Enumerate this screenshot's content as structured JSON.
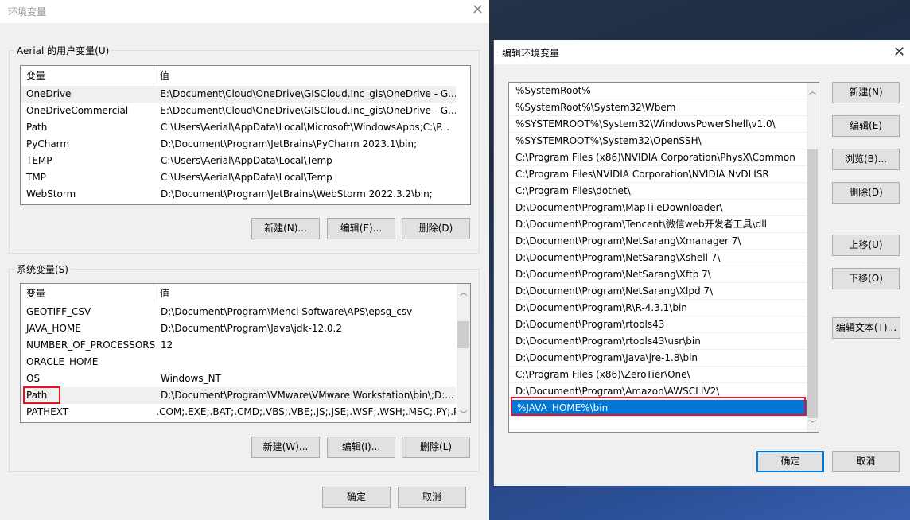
{
  "env_dialog": {
    "title": "环境变量",
    "user_group": {
      "label": "Aerial 的用户变量(U)",
      "headers": [
        "变量",
        "值"
      ],
      "rows": [
        [
          "OneDrive",
          "E:\\Document\\Cloud\\OneDrive\\GISCloud.Inc_gis\\OneDrive - G..."
        ],
        [
          "OneDriveCommercial",
          "E:\\Document\\Cloud\\OneDrive\\GISCloud.Inc_gis\\OneDrive - G..."
        ],
        [
          "Path",
          "C:\\Users\\Aerial\\AppData\\Local\\Microsoft\\WindowsApps;C:\\P..."
        ],
        [
          "PyCharm",
          "D:\\Document\\Program\\JetBrains\\PyCharm 2023.1\\bin;"
        ],
        [
          "TEMP",
          "C:\\Users\\Aerial\\AppData\\Local\\Temp"
        ],
        [
          "TMP",
          "C:\\Users\\Aerial\\AppData\\Local\\Temp"
        ],
        [
          "WebStorm",
          "D:\\Document\\Program\\JetBrains\\WebStorm 2022.3.2\\bin;"
        ]
      ],
      "buttons": [
        "新建(N)...",
        "编辑(E)...",
        "删除(D)"
      ]
    },
    "system_group": {
      "label": "系统变量(S)",
      "headers": [
        "变量",
        "值"
      ],
      "rows": [
        [
          "GEOTIFF_CSV",
          "D:\\Document\\Program\\Menci Software\\APS\\epsg_csv"
        ],
        [
          "JAVA_HOME",
          "D:\\Document\\Program\\Java\\jdk-12.0.2"
        ],
        [
          "NUMBER_OF_PROCESSORS",
          "12"
        ],
        [
          "ORACLE_HOME",
          ""
        ],
        [
          "OS",
          "Windows_NT"
        ],
        [
          "Path",
          "D:\\Document\\Program\\VMware\\VMware Workstation\\bin\\;D:..."
        ],
        [
          "PATHEXT",
          ".COM;.EXE;.BAT;.CMD;.VBS;.VBE;.JS;.JSE;.WSF;.WSH;.MSC;.PY;.P..."
        ]
      ],
      "buttons": [
        "新建(W)...",
        "编辑(I)...",
        "删除(L)"
      ]
    },
    "ok": "确定",
    "cancel": "取消"
  },
  "edit_dialog": {
    "title": "编辑环境变量",
    "entries": [
      "%SystemRoot%",
      "%SystemRoot%\\System32\\Wbem",
      "%SYSTEMROOT%\\System32\\WindowsPowerShell\\v1.0\\",
      "%SYSTEMROOT%\\System32\\OpenSSH\\",
      "C:\\Program Files (x86)\\NVIDIA Corporation\\PhysX\\Common",
      "C:\\Program Files\\NVIDIA Corporation\\NVIDIA NvDLISR",
      "C:\\Program Files\\dotnet\\",
      "D:\\Document\\Program\\MapTileDownloader\\",
      "D:\\Document\\Program\\Tencent\\微信web开发者工具\\dll",
      "D:\\Document\\Program\\NetSarang\\Xmanager 7\\",
      "D:\\Document\\Program\\NetSarang\\Xshell 7\\",
      "D:\\Document\\Program\\NetSarang\\Xftp 7\\",
      "D:\\Document\\Program\\NetSarang\\Xlpd 7\\",
      "D:\\Document\\Program\\R\\R-4.3.1\\bin",
      "D:\\Document\\Program\\rtools43",
      "D:\\Document\\Program\\rtools43\\usr\\bin",
      "D:\\Document\\Program\\Java\\jre-1.8\\bin",
      "C:\\Program Files (x86)\\ZeroTier\\One\\",
      "D:\\Document\\Program\\Amazon\\AWSCLIV2\\",
      "%JAVA_HOME%\\bin"
    ],
    "selected_index": 19,
    "buttons": [
      "新建(N)",
      "编辑(E)",
      "浏览(B)...",
      "删除(D)",
      "上移(U)",
      "下移(O)",
      "编辑文本(T)..."
    ],
    "ok": "确定",
    "cancel": "取消",
    "accent": "#0078d7",
    "highlight": "#e81123"
  }
}
